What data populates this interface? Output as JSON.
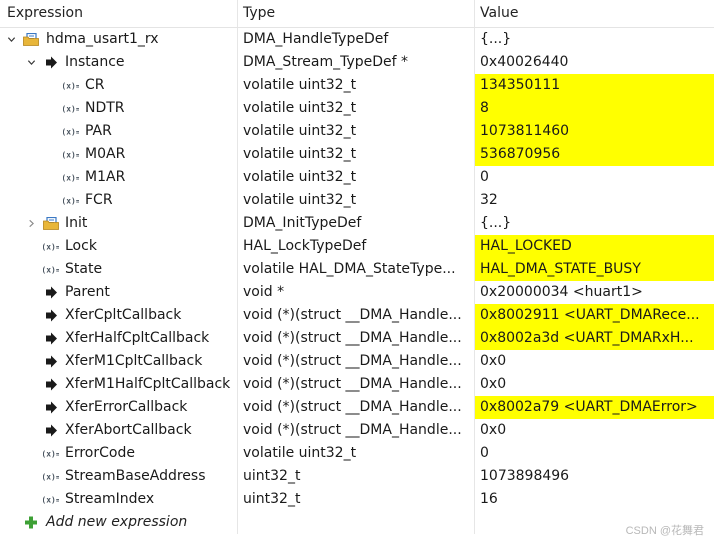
{
  "header": {
    "expression": "Expression",
    "type": "Type",
    "value": "Value"
  },
  "rows": [
    {
      "name": "hdma_usart1_rx",
      "type": "DMA_HandleTypeDef",
      "value": "{...}",
      "icon": "struct-icon",
      "twisty": "expanded",
      "level": 0,
      "highlight": false
    },
    {
      "name": "Instance",
      "type": "DMA_Stream_TypeDef *",
      "value": "0x40026440",
      "icon": "pointer-icon",
      "twisty": "expanded",
      "level": 1,
      "highlight": false
    },
    {
      "name": "CR",
      "type": "volatile uint32_t",
      "value": "134350111",
      "icon": "variable-icon",
      "twisty": "none",
      "level": 2,
      "highlight": true
    },
    {
      "name": "NDTR",
      "type": "volatile uint32_t",
      "value": "8",
      "icon": "variable-icon",
      "twisty": "none",
      "level": 2,
      "highlight": true
    },
    {
      "name": "PAR",
      "type": "volatile uint32_t",
      "value": "1073811460",
      "icon": "variable-icon",
      "twisty": "none",
      "level": 2,
      "highlight": true
    },
    {
      "name": "M0AR",
      "type": "volatile uint32_t",
      "value": "536870956",
      "icon": "variable-icon",
      "twisty": "none",
      "level": 2,
      "highlight": true
    },
    {
      "name": "M1AR",
      "type": "volatile uint32_t",
      "value": "0",
      "icon": "variable-icon",
      "twisty": "none",
      "level": 2,
      "highlight": false
    },
    {
      "name": "FCR",
      "type": "volatile uint32_t",
      "value": "32",
      "icon": "variable-icon",
      "twisty": "none",
      "level": 2,
      "highlight": false
    },
    {
      "name": "Init",
      "type": "DMA_InitTypeDef",
      "value": "{...}",
      "icon": "struct-icon",
      "twisty": "collapsed",
      "level": 1,
      "highlight": false
    },
    {
      "name": "Lock",
      "type": "HAL_LockTypeDef",
      "value": "HAL_LOCKED",
      "icon": "variable-icon",
      "twisty": "none",
      "level": 1,
      "highlight": true
    },
    {
      "name": "State",
      "type": "volatile HAL_DMA_StateType...",
      "value": "HAL_DMA_STATE_BUSY",
      "icon": "variable-icon",
      "twisty": "none",
      "level": 1,
      "highlight": true
    },
    {
      "name": "Parent",
      "type": "void *",
      "value": "0x20000034 <huart1>",
      "icon": "pointer-icon",
      "twisty": "none",
      "level": 1,
      "highlight": false
    },
    {
      "name": "XferCpltCallback",
      "type": "void (*)(struct __DMA_Handle...",
      "value": "0x8002911 <UART_DMARece...",
      "icon": "pointer-icon",
      "twisty": "none",
      "level": 1,
      "highlight": true
    },
    {
      "name": "XferHalfCpltCallback",
      "type": "void (*)(struct __DMA_Handle...",
      "value": "0x8002a3d <UART_DMARxH...",
      "icon": "pointer-icon",
      "twisty": "none",
      "level": 1,
      "highlight": true
    },
    {
      "name": "XferM1CpltCallback",
      "type": "void (*)(struct __DMA_Handle...",
      "value": "0x0",
      "icon": "pointer-icon",
      "twisty": "none",
      "level": 1,
      "highlight": false
    },
    {
      "name": "XferM1HalfCpltCallback",
      "type": "void (*)(struct __DMA_Handle...",
      "value": "0x0",
      "icon": "pointer-icon",
      "twisty": "none",
      "level": 1,
      "highlight": false
    },
    {
      "name": "XferErrorCallback",
      "type": "void (*)(struct __DMA_Handle...",
      "value": "0x8002a79 <UART_DMAError>",
      "icon": "pointer-icon",
      "twisty": "none",
      "level": 1,
      "highlight": true
    },
    {
      "name": "XferAbortCallback",
      "type": "void (*)(struct __DMA_Handle...",
      "value": "0x0",
      "icon": "pointer-icon",
      "twisty": "none",
      "level": 1,
      "highlight": false
    },
    {
      "name": "ErrorCode",
      "type": "volatile uint32_t",
      "value": "0",
      "icon": "variable-icon",
      "twisty": "none",
      "level": 1,
      "highlight": false
    },
    {
      "name": "StreamBaseAddress",
      "type": "uint32_t",
      "value": "1073898496",
      "icon": "variable-icon",
      "twisty": "none",
      "level": 1,
      "highlight": false
    },
    {
      "name": "StreamIndex",
      "type": "uint32_t",
      "value": "16",
      "icon": "variable-icon",
      "twisty": "none",
      "level": 1,
      "highlight": false
    }
  ],
  "add_expression": {
    "label": "Add new expression",
    "icon": "plus-icon"
  },
  "watermark": "CSDN @花舞君",
  "colors": {
    "highlight": "#ffff00",
    "plus": "#3da035",
    "pointer": "#1a1a1a",
    "struct_folder": "#e8b63a",
    "struct_sheet": "#3a78c4"
  }
}
